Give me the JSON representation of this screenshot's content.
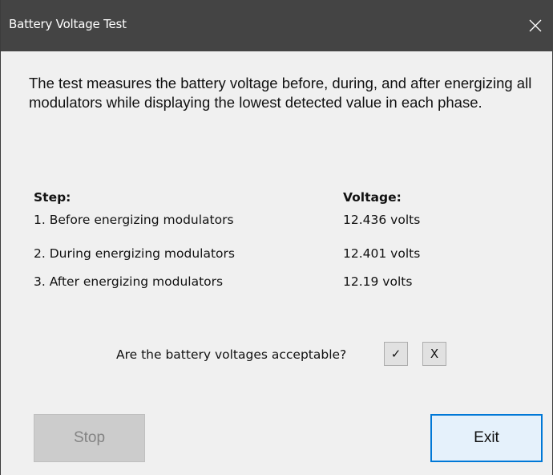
{
  "window": {
    "title": "Battery Voltage Test"
  },
  "description": "The test measures the battery voltage before, during, and after energizing all modulators while displaying the lowest detected value in each phase.",
  "table": {
    "headers": {
      "step": "Step:",
      "voltage": "Voltage:"
    },
    "rows": [
      {
        "step": "1. Before energizing modulators",
        "voltage": "12.436 volts"
      },
      {
        "step": "2. During energizing modulators",
        "voltage": "12.401 volts"
      },
      {
        "step": "3. After energizing modulators",
        "voltage": "12.19 volts"
      }
    ]
  },
  "question": {
    "text": "Are the battery voltages acceptable?",
    "yes_label": "✓",
    "no_label": "X"
  },
  "buttons": {
    "stop_label": "Stop",
    "exit_label": "Exit"
  },
  "colors": {
    "titlebar": "#444444",
    "dialog_background": "#f0f0f0",
    "focus_border": "#0078d7",
    "disabled_button": "#cccccc"
  },
  "icons": {
    "close": "close-icon"
  },
  "state": {
    "stop_enabled": false,
    "exit_focused": true
  }
}
